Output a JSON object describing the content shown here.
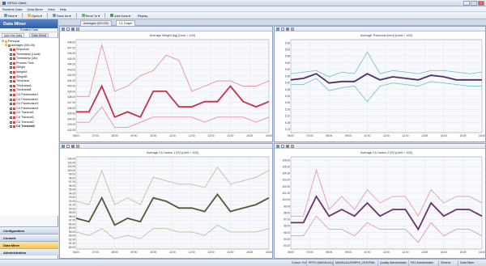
{
  "window": {
    "title": "SPS11 Client"
  },
  "menu": [
    "Runtime Data",
    "Data Miner",
    "View",
    "Help"
  ],
  "toolbar": {
    "new": "New",
    "open": "Open",
    "save_as": "Save As",
    "send_to": "Send To",
    "add_data": "Add Data",
    "replay": "Replay"
  },
  "sidebar": {
    "title": "Data Miner",
    "runtime_label": "Runtime Data",
    "tab_add_hist": "Add Hist Data",
    "tab_data_sheet": "Data Sheet",
    "tree": {
      "root": "Personal",
      "child": "averages (001:00)",
      "items": [
        "Sequence",
        "Timestamp (Local)",
        "Timestamp (Utc)",
        "Process Time",
        "Weight",
        "WeightA",
        "WeightB",
        "Thickness",
        "ThicknessA",
        "ThicknessB",
        "CU Paramvalue1",
        "CU Paramvalue2",
        "CU Paramvalue3",
        "CU Paramvalue4",
        "CU Transval1",
        "CU Transval2",
        "CU Transval3",
        "CU Transval4"
      ]
    },
    "nav": [
      "Configuration",
      "Console",
      "Data Miner",
      "Administration"
    ],
    "nav_active": 2
  },
  "tabs": [
    "averages (001:00)",
    "CL Graph"
  ],
  "tab_active": 1,
  "time_labels": [
    "06:00",
    "07:00",
    "08:00",
    "09:00",
    "10:00",
    "11:00",
    "12:00",
    "13:00",
    "14:00",
    "15:00",
    "16:00"
  ],
  "charts": [
    {
      "title": "Average Weight [kg] (Limit = 100)",
      "ylim": [
        431,
        449
      ],
      "yticks": [
        "448.00",
        "447.00",
        "446.00",
        "445.00",
        "444.00",
        "443.00",
        "442.00",
        "441.00",
        "440.00",
        "439.00",
        "438.00",
        "437.00",
        "436.00",
        "435.00",
        "434.00",
        "433.00",
        "432.00"
      ],
      "colors": {
        "main": "#c8304a",
        "limits": "#e8909c"
      },
      "series": {
        "upper": [
          438,
          438,
          448,
          439,
          440,
          442,
          443,
          446,
          445,
          439,
          440,
          441,
          441,
          440,
          440,
          441
        ],
        "main": [
          435,
          435,
          440,
          434,
          435,
          434,
          439,
          439,
          436,
          436,
          437,
          437,
          440,
          437,
          436,
          437
        ],
        "lower": [
          433,
          433,
          436,
          432,
          432,
          433,
          434,
          434,
          434,
          434,
          433,
          434,
          434,
          434,
          433,
          434
        ]
      }
    },
    {
      "title": "Average Thickness [mm] (Limit = 100)",
      "ylim": [
        5.1,
        5.7
      ],
      "yticks": [
        "5.66",
        "5.62",
        "5.58",
        "5.54",
        "5.50",
        "5.46",
        "5.42",
        "5.38",
        "5.34",
        "5.30",
        "5.26",
        "5.22",
        "5.18",
        "5.14"
      ],
      "colors": {
        "main": "#4a2f6e",
        "limits": "#7fc3cc"
      },
      "series": {
        "upper": [
          5.48,
          5.49,
          5.5,
          5.46,
          5.49,
          5.48,
          5.62,
          5.48,
          5.5,
          5.49,
          5.48,
          5.5,
          5.5,
          5.49,
          5.48,
          5.49
        ],
        "main": [
          5.44,
          5.45,
          5.48,
          5.42,
          5.43,
          5.43,
          5.48,
          5.44,
          5.46,
          5.45,
          5.44,
          5.47,
          5.46,
          5.44,
          5.44,
          5.44
        ],
        "lower": [
          5.41,
          5.41,
          5.45,
          5.37,
          5.39,
          5.4,
          5.3,
          5.4,
          5.42,
          5.41,
          5.4,
          5.43,
          5.42,
          5.41,
          5.4,
          5.4
        ]
      }
    },
    {
      "title": "Average CU Instno 1 [%] (Limit = 100)",
      "ylim": [
        79,
        106
      ],
      "yticks": [
        "105.00",
        "104.00",
        "102.00",
        "100.00",
        "99.00",
        "98.00",
        "97.00",
        "96.00",
        "95.00",
        "94.00",
        "93.00",
        "92.00",
        "91.00",
        "90.00",
        "89.00",
        "88.00",
        "87.00",
        "86.00",
        "85.00",
        "84.00",
        "83.00",
        "82.00",
        "81.00",
        "80.00"
      ],
      "colors": {
        "main": "#4f5a33",
        "limits": "#b8c2a0"
      },
      "series": {
        "upper": [
          93,
          92,
          102,
          92,
          94,
          92,
          100,
          99,
          98,
          98,
          97,
          103,
          98,
          99,
          100,
          102
        ],
        "main": [
          88,
          87,
          94,
          86,
          88,
          87,
          94,
          93,
          91,
          91,
          90,
          95,
          90,
          91,
          92,
          94
        ],
        "lower": [
          84,
          83,
          85,
          82,
          83,
          82,
          85,
          85,
          84,
          84,
          83,
          86,
          84,
          84,
          84,
          85
        ]
      }
    },
    {
      "title": "Average CU Instno 2 [%] (Limit = 100)",
      "ylim": [
        92,
        106
      ],
      "yticks": [
        "106.00",
        "105.00",
        "104.00",
        "103.00",
        "102.00",
        "101.00",
        "100.00",
        "99.00",
        "98.00",
        "97.00",
        "96.00",
        "95.00",
        "94.00",
        "93.00"
      ],
      "colors": {
        "main": "#6e2f6c",
        "limits": "#e39ab4"
      },
      "series": {
        "upper": [
          97,
          97,
          104,
          98,
          100,
          98,
          101,
          99,
          100,
          100,
          97,
          101,
          99,
          100,
          100,
          99
        ],
        "main": [
          96,
          96,
          100,
          97,
          98,
          97,
          99,
          97,
          98,
          98,
          95,
          99,
          97,
          98,
          98,
          97
        ],
        "lower": [
          94,
          94,
          97,
          95,
          95,
          94,
          96,
          95,
          95,
          95,
          93,
          96,
          94,
          95,
          95,
          94
        ]
      }
    }
  ],
  "status": {
    "cursor": "Cursor: Full",
    "host": "PRTS (MAGA1A1)",
    "db": "MAGA1A1ZSMPHI_CENTRAL",
    "role": "Quality Administrator",
    "user": "PAT Administrator",
    "view": "Generic",
    "module": "Data Miner"
  }
}
